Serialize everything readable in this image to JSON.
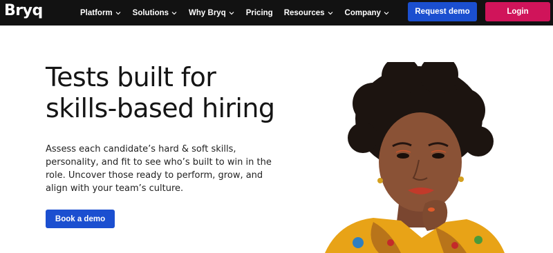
{
  "brand": {
    "logo_text": "Bryq"
  },
  "nav": {
    "items": [
      {
        "label": "Platform",
        "has_dropdown": true
      },
      {
        "label": "Solutions",
        "has_dropdown": true
      },
      {
        "label": "Why Bryq",
        "has_dropdown": true
      },
      {
        "label": "Pricing",
        "has_dropdown": false
      },
      {
        "label": "Resources",
        "has_dropdown": true
      },
      {
        "label": "Company",
        "has_dropdown": true
      }
    ],
    "request_demo_label": "Request demo",
    "login_label": "Login"
  },
  "hero": {
    "title_line1": "Tests built for",
    "title_line2": "skills-based hiring",
    "description": "Assess each candidate’s hard & soft skills, personality, and fit to see who’s built to win in the role. Uncover those ready to perform, grow, and align with your team’s culture.",
    "cta_label": "Book a demo",
    "image_icon": "smiling-woman-portrait"
  },
  "colors": {
    "nav_background": "#121212",
    "primary_blue": "#1b4fd0",
    "login_pink": "#d0145a",
    "heading_text": "#151515"
  }
}
